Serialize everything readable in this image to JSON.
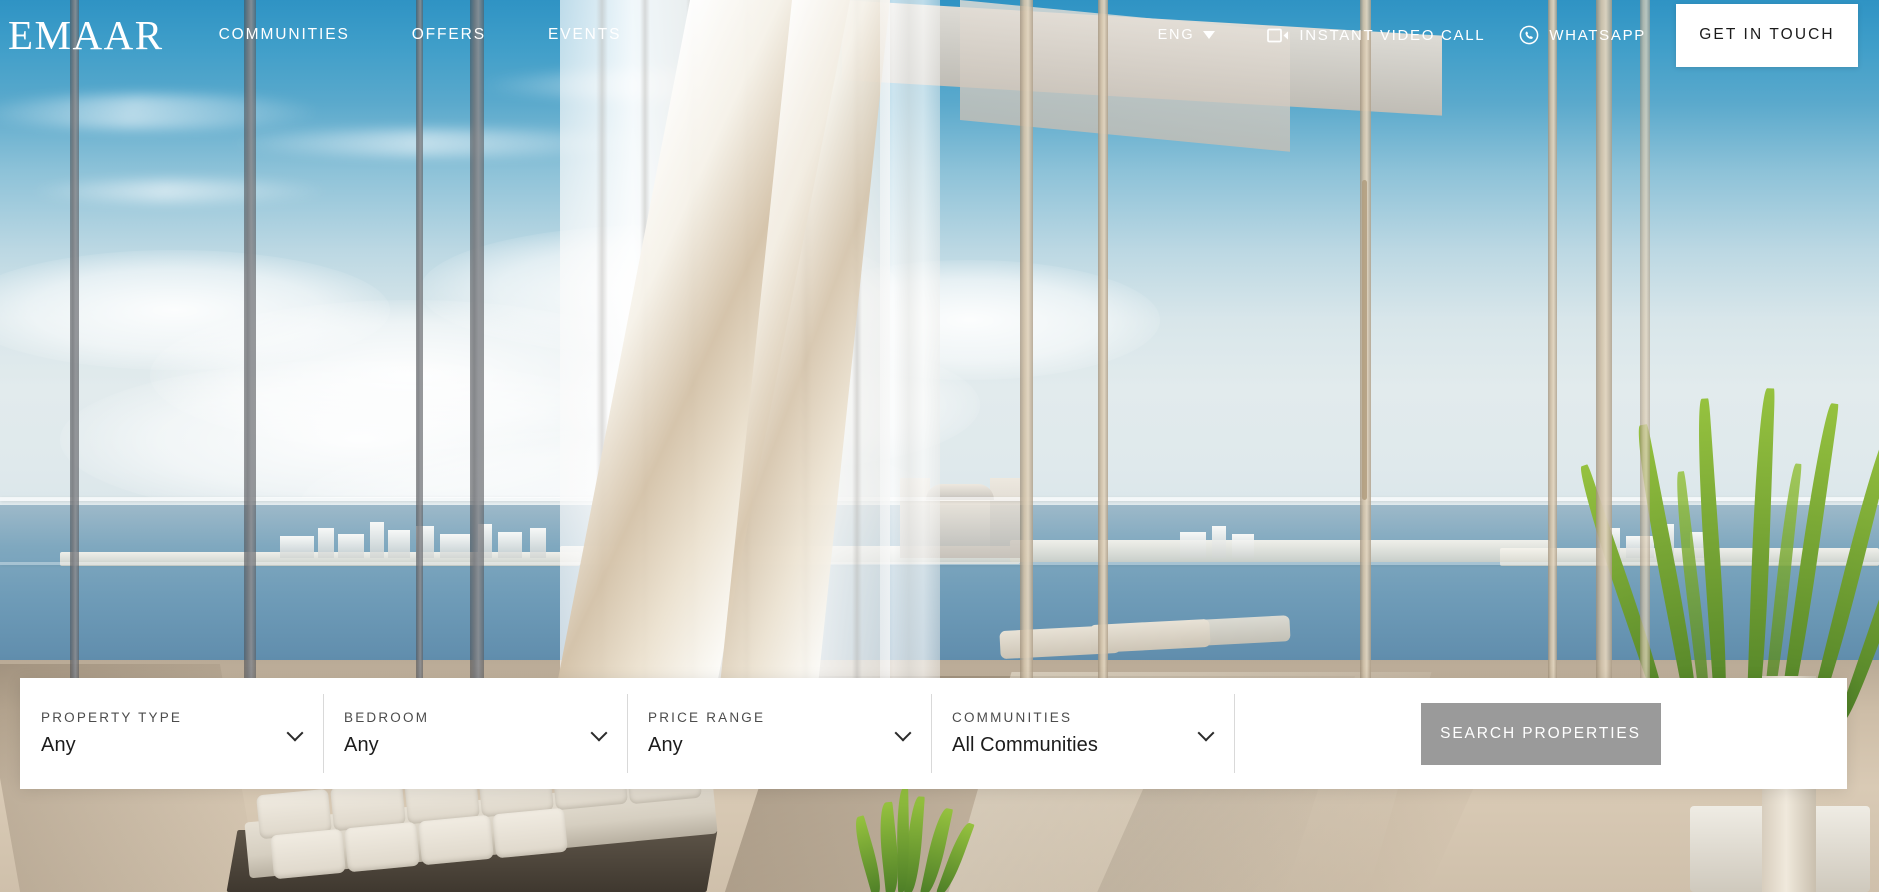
{
  "brand": {
    "logo_text": "EMAAR"
  },
  "nav": {
    "items": [
      {
        "label": "COMMUNITIES",
        "name": "nav-communities"
      },
      {
        "label": "OFFERS",
        "name": "nav-offers"
      },
      {
        "label": "EVENTS",
        "name": "nav-events"
      }
    ]
  },
  "header": {
    "language": {
      "label": "ENG",
      "icon": "chevron-down-icon"
    },
    "video_call": {
      "label": "INSTANT VIDEO CALL",
      "icon": "video-camera-icon"
    },
    "whatsapp": {
      "label": "WHATSAPP",
      "icon": "whatsapp-icon"
    },
    "cta_label": "GET IN TOUCH"
  },
  "search": {
    "fields": [
      {
        "label": "PROPERTY TYPE",
        "value": "Any",
        "name": "property-type"
      },
      {
        "label": "BEDROOM",
        "value": "Any",
        "name": "bedroom"
      },
      {
        "label": "PRICE RANGE",
        "value": "Any",
        "name": "price-range"
      },
      {
        "label": "COMMUNITIES",
        "value": "All Communities",
        "name": "communities"
      }
    ],
    "submit_label": "SEARCH PROPERTIES"
  },
  "colors": {
    "cta_background": "#ffffff",
    "cta_text": "#1b1b1b",
    "search_button_background": "#9a9a9a",
    "search_button_text": "#ffffff",
    "search_bar_background": "#ffffff",
    "field_label": "#4c4c4c",
    "field_value": "#1c1c1c",
    "divider": "#d9d9d9",
    "header_text": "#ffffff"
  },
  "hero": {
    "description": "Penthouse interior with floor-to-ceiling windows, sheer white curtains, ocean and Palm Jumeirah view, sun loungers and a potted plant"
  }
}
